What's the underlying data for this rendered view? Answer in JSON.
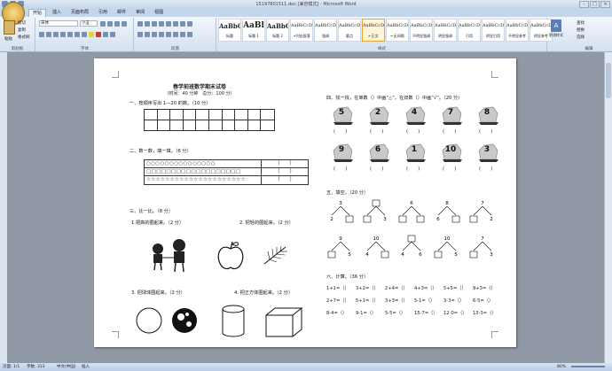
{
  "window": {
    "title": "15197801511.doc [兼容模式] - Microsoft Word",
    "controls": [
      "–",
      "□",
      "×"
    ]
  },
  "ribbon": {
    "tabs": [
      "开始",
      "插入",
      "页面布局",
      "引用",
      "邮件",
      "审阅",
      "视图"
    ],
    "active_tab": "开始",
    "clipboard": {
      "paste": "粘贴",
      "cut": "剪切",
      "copy": "复制",
      "format_painter": "格式刷",
      "label": "剪贴板"
    },
    "font": {
      "name": "宋体",
      "size": "小五",
      "label": "字体"
    },
    "paragraph": {
      "label": "段落"
    },
    "styles": {
      "label": "样式",
      "items": [
        {
          "preview": "AaBbC",
          "name": "标题"
        },
        {
          "preview": "AaBl",
          "name": "标题 1"
        },
        {
          "preview": "AaBbC",
          "name": "标题 2"
        },
        {
          "preview": "AaBbCcDc",
          "name": "+列出段落"
        },
        {
          "preview": "AaBbCcDc",
          "name": "强调"
        },
        {
          "preview": "AaBbCcD",
          "name": "要点"
        },
        {
          "preview": "AaBbCcDc",
          "name": "↵正文"
        },
        {
          "preview": "AaBbCcDc",
          "name": "↵无间隔"
        },
        {
          "preview": "AaBbCcDc",
          "name": "不明显强调"
        },
        {
          "preview": "AaBbCcDc",
          "name": "明显强调"
        },
        {
          "preview": "AaBbCcDc",
          "name": "引用"
        },
        {
          "preview": "AaBbCcDc",
          "name": "明显引用"
        },
        {
          "preview": "AaBbCcDt",
          "name": "不明显参考"
        },
        {
          "preview": "AaBbCcDt",
          "name": "明显参考"
        }
      ],
      "selected_index": 6,
      "change_styles": "更改样式"
    },
    "editing": {
      "find": "查找",
      "replace": "替换",
      "select": "选择",
      "label": "编辑"
    }
  },
  "status": {
    "page": "页面: 1/1",
    "words": "字数: 313",
    "lang": "中文(中国)",
    "mode": "插入",
    "zoom": "80%"
  },
  "doc": {
    "title": "春学前班数学期末试卷",
    "subtitle": "（时间：40 分钟　总分：100 分）",
    "q1": "一、按顺序写出 1—20 的数。（10 分）",
    "q2": "二、数一数，填一填。（6 分）",
    "q2_rows": [
      {
        "symbols": "○○○○○○○○○○○○○○○",
        "answer": "（　　）"
      },
      {
        "symbols": "□□□□□□□□□□□□□□□□□□□",
        "answer": "（　　）"
      },
      {
        "symbols": "☆☆☆☆☆☆☆☆☆☆☆☆☆☆☆☆☆☆☆☆☆",
        "answer": "（　　）"
      }
    ],
    "q3": "三、比一比。（8 分）",
    "q3_1": "1.把高的圈起来。（2 分）",
    "q3_2": "2. 把轻的圈起来。（2 分）",
    "q3_3": "3. 把球体圈起来。（2 分）",
    "q3_4": "4. 把正方体圈起来。（2 分）",
    "q4": "四、找一找，在单数（）中画“△”，在双数（）中画“√”。（20 分）",
    "q4_numbers": [
      "5",
      "2",
      "4",
      "7",
      "8",
      "9",
      "6",
      "1",
      "10",
      "3"
    ],
    "q4_paren": "(　　)",
    "q5": "五、填空。（20 分）",
    "q5_trees_row1": [
      [
        "2",
        ""
      ],
      [
        "",
        "3"
      ],
      [
        "",
        ""
      ],
      [
        "6",
        ""
      ],
      [
        "",
        "2"
      ]
    ],
    "q5_trees_row2": [
      [
        "",
        "5"
      ],
      [
        "4",
        ""
      ],
      [
        "4",
        "6"
      ],
      [
        "",
        "5"
      ],
      [
        "",
        "3"
      ]
    ],
    "q5_trees_row1_top": [
      "3",
      "",
      "6",
      "8",
      "7"
    ],
    "q5_trees_row2_top": [
      "9",
      "10",
      "",
      "10",
      "7"
    ],
    "q6": "六、计算。（36 分）",
    "q6_rows": [
      [
        "1+1=（）",
        "3+2=（）",
        "2+4=（）",
        "4+3=（）",
        "5+5=（）",
        "9+3=（）"
      ],
      [
        "2+7=（）",
        "5+1=（）",
        "3+3=（）",
        "5-1=（）",
        "3-3=（）",
        "6-5=（）"
      ],
      [
        "8-4=（）",
        "9-1=（）",
        "5-5=（）",
        "15-7=（）",
        "12-0=（）",
        "13-3=（）"
      ]
    ]
  }
}
